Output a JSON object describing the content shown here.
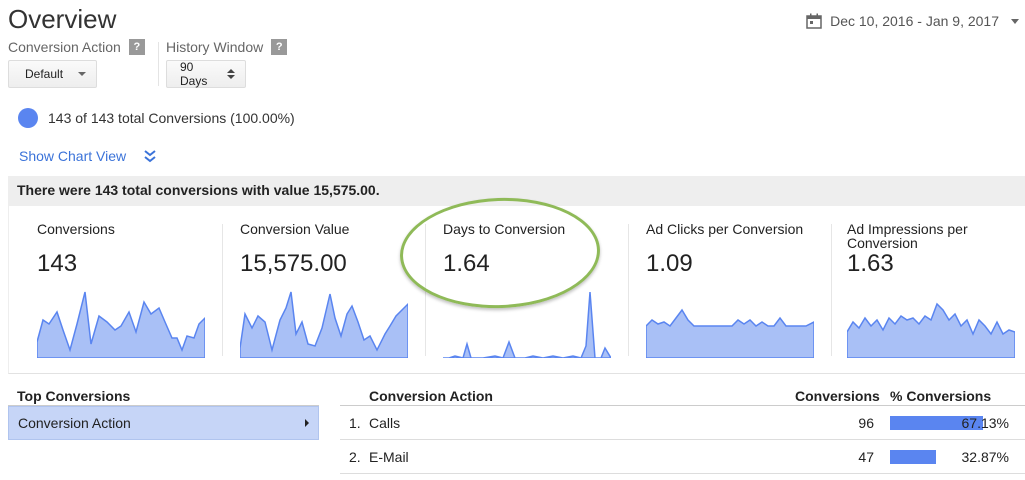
{
  "header": {
    "title": "Overview",
    "date_range": "Dec 10, 2016 - Jan 9, 2017"
  },
  "controls": {
    "conversion_action": {
      "label": "Conversion Action",
      "help": "?",
      "value": "Default"
    },
    "history_window": {
      "label": "History Window",
      "help": "?",
      "value": "90 Days"
    }
  },
  "segment": {
    "text": "143 of 143 total Conversions (100.00%)",
    "color": "#5a85f0"
  },
  "chart_view": {
    "label": "Show Chart View"
  },
  "summary": {
    "text": "There were 143 total conversions with value 15,575.00."
  },
  "metrics": [
    {
      "name": "Conversions",
      "value": "143"
    },
    {
      "name": "Conversion Value",
      "value": "15,575.00"
    },
    {
      "name": "Days to Conversion",
      "value": "1.64"
    },
    {
      "name": "Ad Clicks per Conversion",
      "value": "1.09"
    },
    {
      "name": "Ad Impressions per Conversion",
      "value": "1.63"
    }
  ],
  "top_conversions": {
    "title": "Top Conversions",
    "item": "Conversion Action"
  },
  "table": {
    "headers": {
      "action": "Conversion Action",
      "conversions": "Conversions",
      "pct": "% Conversions"
    },
    "rows": [
      {
        "index": "1.",
        "action": "Calls",
        "conversions": "96",
        "pct": "67.13%",
        "share": 0.6713
      },
      {
        "index": "2.",
        "action": "E-Mail",
        "conversions": "47",
        "pct": "32.87%",
        "share": 0.3287
      }
    ]
  },
  "colors": {
    "accent": "#5a85f0",
    "sparkline": "#a9c0f6",
    "highlight": "#8fba58"
  }
}
